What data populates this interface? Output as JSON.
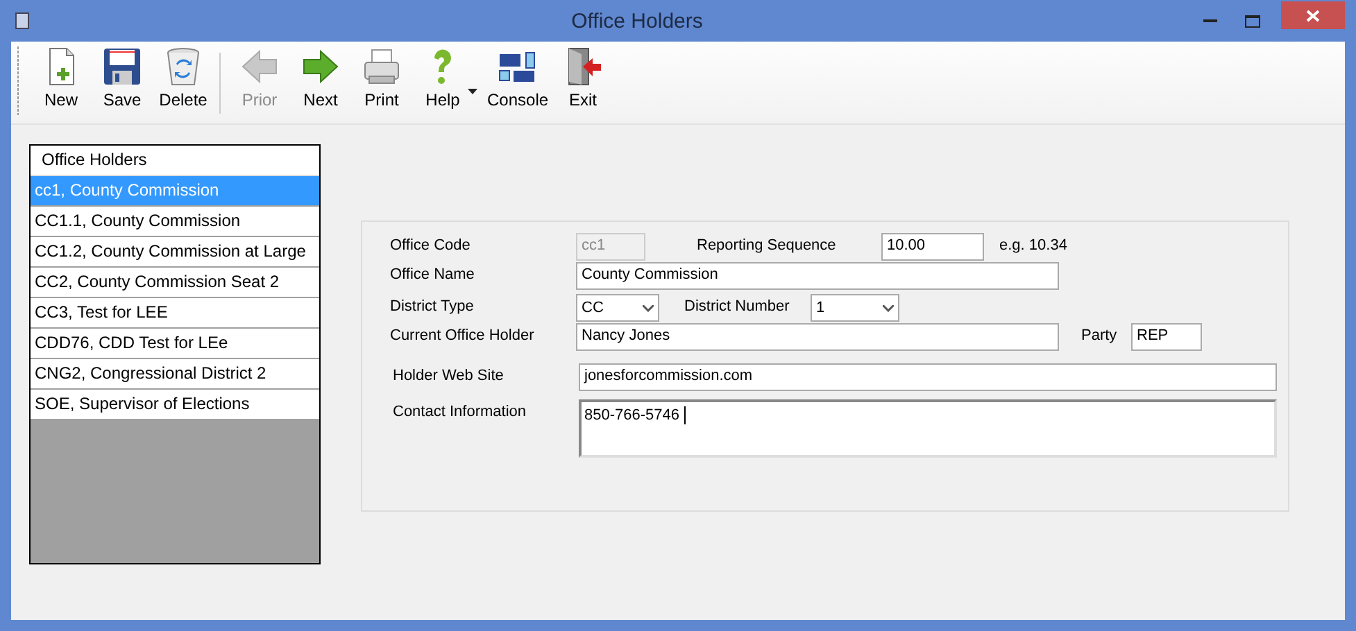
{
  "window": {
    "title": "Office Holders"
  },
  "toolbar": [
    {
      "label": "New",
      "disabled": false
    },
    {
      "label": "Save",
      "disabled": false
    },
    {
      "label": "Delete",
      "disabled": false
    },
    {
      "kind": "separator"
    },
    {
      "label": "Prior",
      "disabled": true
    },
    {
      "label": "Next",
      "disabled": false
    },
    {
      "label": "Print",
      "disabled": false
    },
    {
      "label": "Help",
      "disabled": false,
      "dropdown": true
    },
    {
      "label": "Console",
      "disabled": false
    },
    {
      "label": "Exit",
      "disabled": false
    }
  ],
  "list": {
    "header": "Office Holders",
    "items": [
      {
        "label": "cc1, County Commission",
        "selected": true
      },
      {
        "label": "CC1.1, County Commission",
        "selected": false
      },
      {
        "label": "CC1.2, County Commission at Large",
        "selected": false
      },
      {
        "label": "CC2, County Commission Seat 2",
        "selected": false
      },
      {
        "label": "CC3, Test for LEE",
        "selected": false
      },
      {
        "label": "CDD76, CDD Test for LEe",
        "selected": false
      },
      {
        "label": "CNG2, Congressional District 2",
        "selected": false
      },
      {
        "label": "SOE, Supervisor of Elections",
        "selected": false
      }
    ]
  },
  "form": {
    "office_code": {
      "label": "Office Code",
      "value": "cc1",
      "disabled": true
    },
    "reporting_sequence": {
      "label": "Reporting Sequence",
      "value": "10.00",
      "hint": "e.g.  10.34"
    },
    "office_name": {
      "label": "Office Name",
      "value": "County Commission"
    },
    "district_type": {
      "label": "District Type",
      "value": "CC"
    },
    "district_number": {
      "label": "District Number",
      "value": "1"
    },
    "current_office_holder": {
      "label": "Current Office Holder",
      "value": "Nancy Jones"
    },
    "party": {
      "label": "Party",
      "value": "REP"
    },
    "holder_web_site": {
      "label": "Holder Web Site",
      "value": "jonesforcommission.com"
    },
    "contact_information": {
      "label": "Contact Information",
      "value": "850-766-5746 "
    }
  }
}
